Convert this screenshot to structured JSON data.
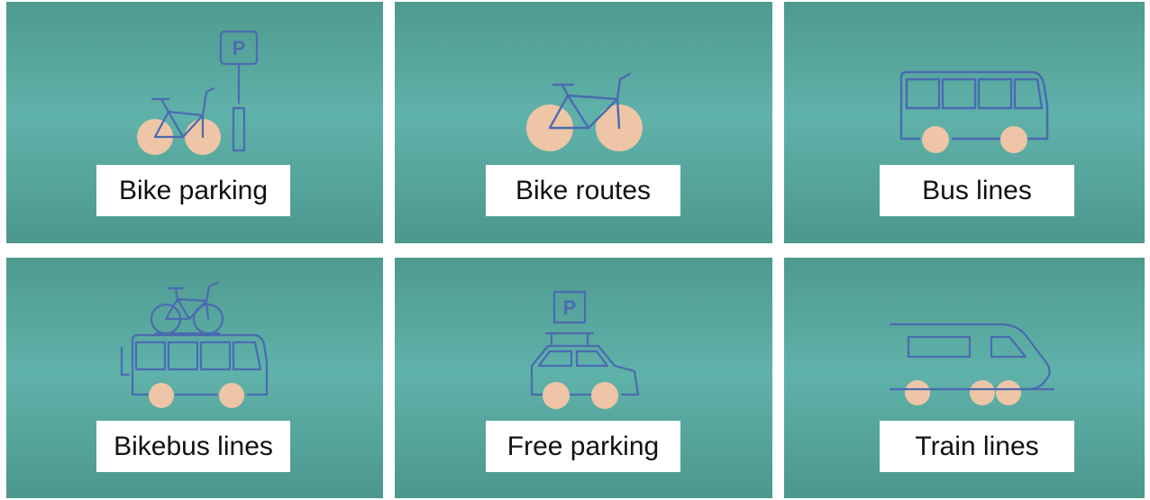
{
  "colors": {
    "tile_top": "#4f9a90",
    "tile_mid": "#5fb2aa",
    "icon_stroke": "#4a6bb0",
    "wheel_fill": "#eec5a6",
    "label_bg": "#ffffff",
    "label_text": "#111111"
  },
  "tiles": [
    {
      "label": "Bike parking",
      "icon": "bike-parking-icon",
      "sign": "P"
    },
    {
      "label": "Bike routes",
      "icon": "bicycle-icon"
    },
    {
      "label": "Bus lines",
      "icon": "bus-icon"
    },
    {
      "label": "Bikebus lines",
      "icon": "bus-with-bike-rack-icon"
    },
    {
      "label": "Free parking",
      "icon": "car-parking-icon",
      "sign": "P"
    },
    {
      "label": "Train lines",
      "icon": "train-icon"
    }
  ]
}
